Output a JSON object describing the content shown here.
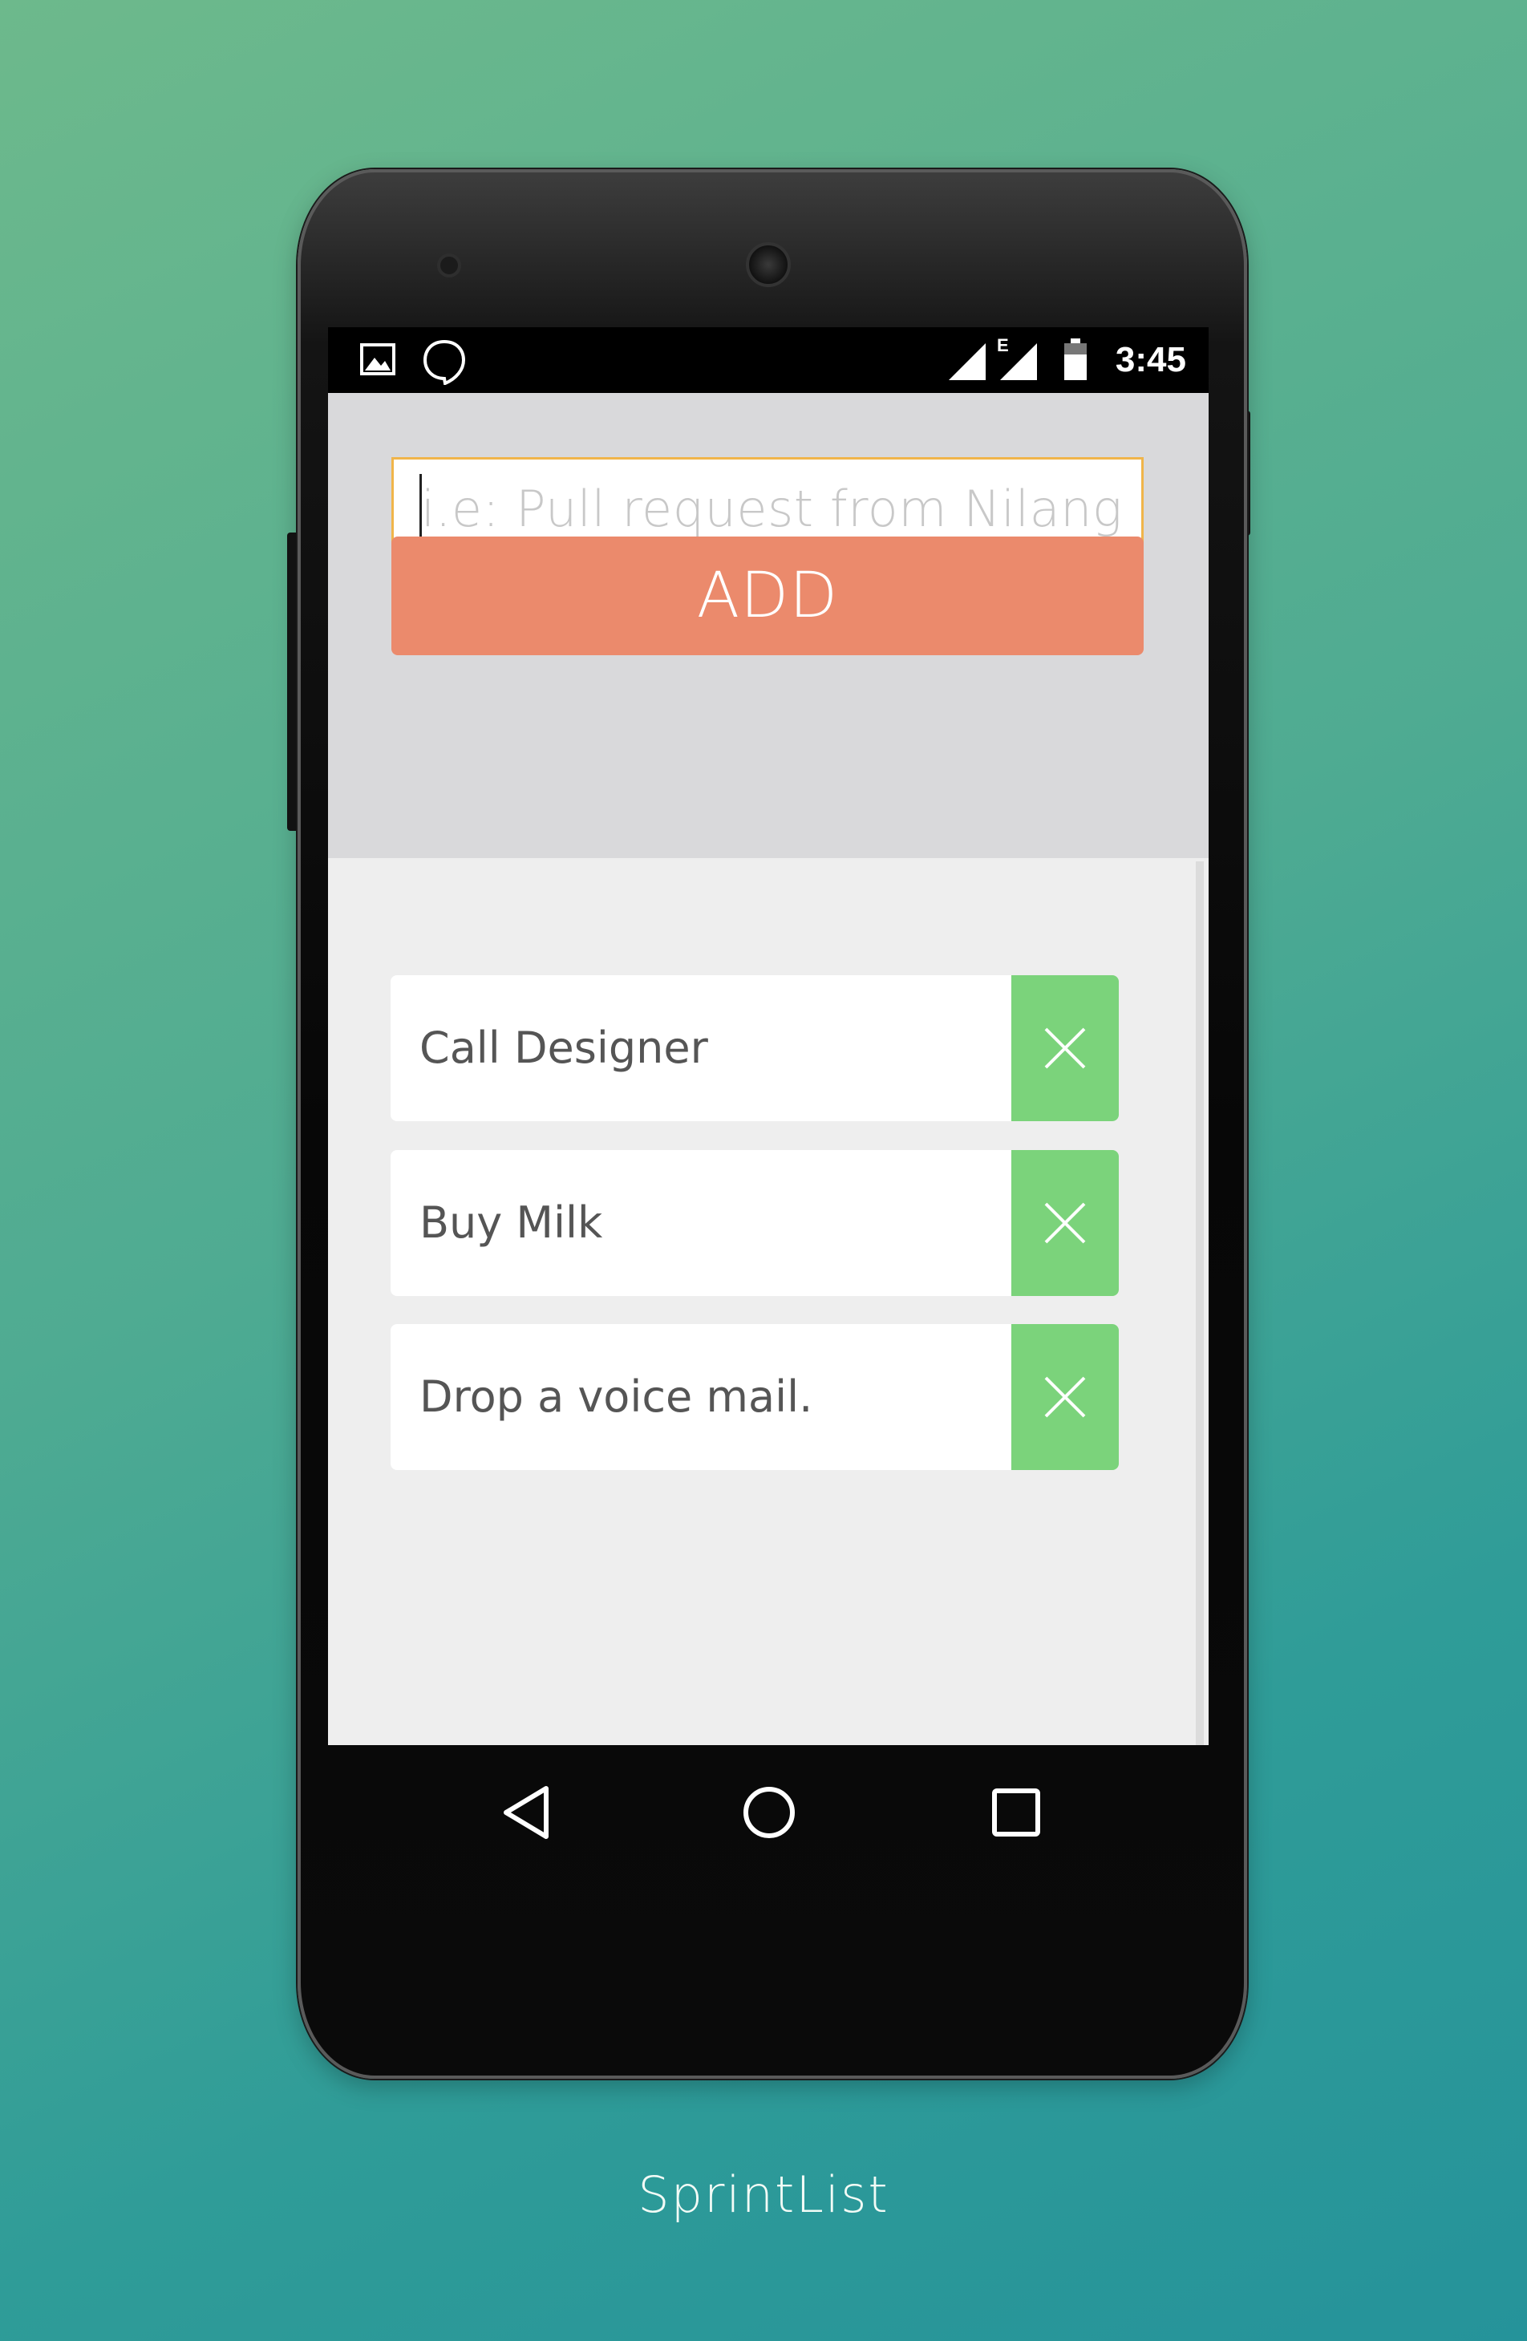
{
  "status_bar": {
    "time": "3:45",
    "icons": [
      "image-icon",
      "hangouts-icon",
      "signal-icon",
      "edge-signal-icon",
      "battery-icon"
    ],
    "network_label": "E"
  },
  "composer": {
    "placeholder": "i.e: Pull request from Nilang",
    "value": "",
    "add_label": "ADD"
  },
  "tasks": [
    {
      "label": "Call Designer"
    },
    {
      "label": "Buy Milk"
    },
    {
      "label": "Drop a voice mail."
    }
  ],
  "nav_icons": [
    "back-icon",
    "home-icon",
    "recents-icon"
  ],
  "footer": {
    "app_name": "SprintList"
  },
  "colors": {
    "background_top": "#6db98c",
    "background_bottom": "#25939a",
    "input_border": "#f0b54a",
    "add_button": "#eb8a6c",
    "remove_button": "#7bd37b",
    "panel": "#d9d9db",
    "list_bg": "#eeeeee"
  }
}
